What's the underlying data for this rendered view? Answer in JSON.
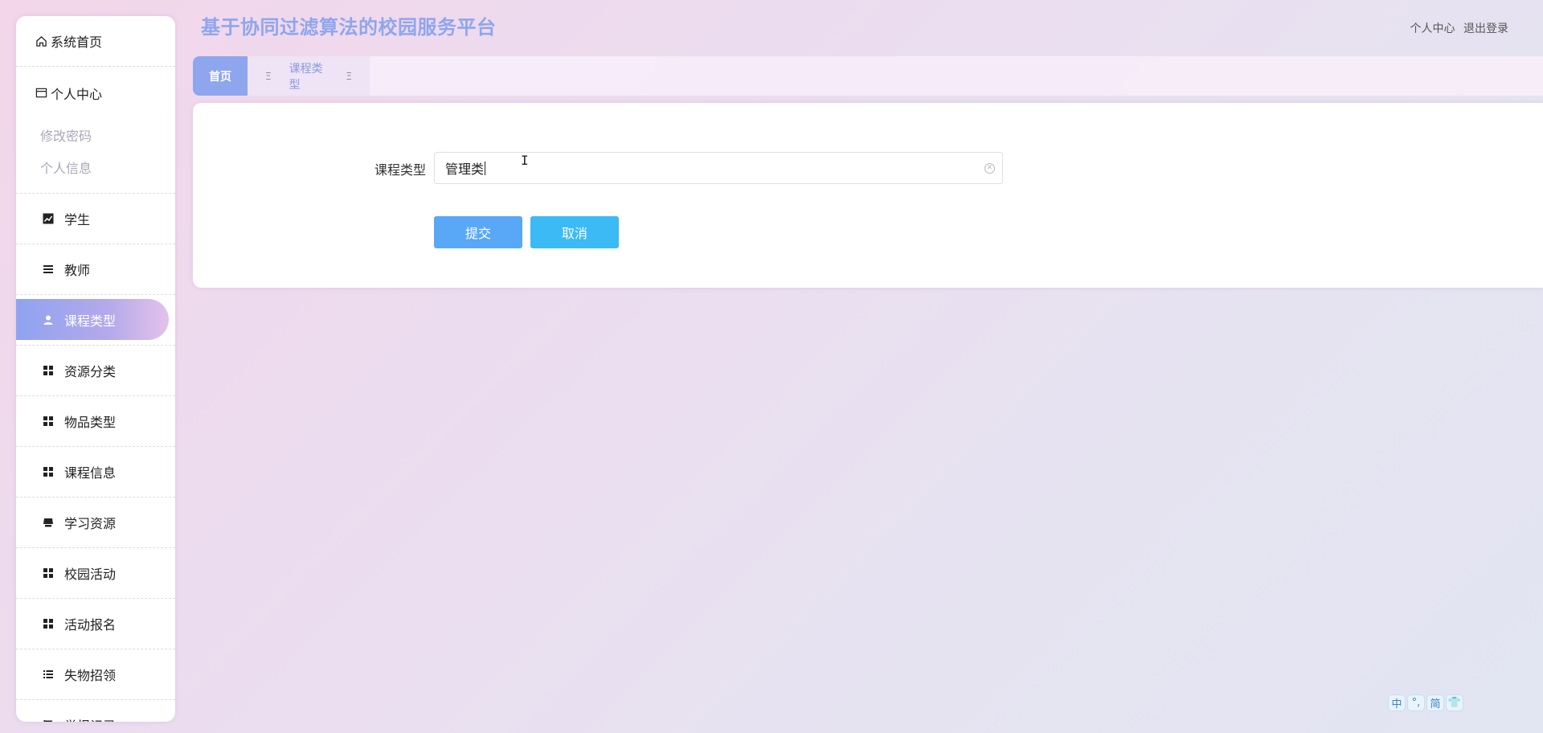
{
  "header": {
    "title": "基于协同过滤算法的校园服务平台",
    "profile_link": "个人中心",
    "logout_link": "退出登录"
  },
  "sidebar": {
    "home": {
      "label": "系统首页",
      "icon": "home-icon"
    },
    "personal": {
      "label": "个人中心",
      "icon": "card-icon",
      "children": [
        {
          "label": "修改密码"
        },
        {
          "label": "个人信息"
        }
      ]
    },
    "items": [
      {
        "label": "学生",
        "icon": "chart-icon"
      },
      {
        "label": "教师",
        "icon": "list-icon"
      },
      {
        "label": "课程类型",
        "icon": "user-icon",
        "active": true
      },
      {
        "label": "资源分类",
        "icon": "grid-icon"
      },
      {
        "label": "物品类型",
        "icon": "grid-icon"
      },
      {
        "label": "课程信息",
        "icon": "grid-icon"
      },
      {
        "label": "学习资源",
        "icon": "shop-icon"
      },
      {
        "label": "校园活动",
        "icon": "grid-icon"
      },
      {
        "label": "活动报名",
        "icon": "grid-icon"
      },
      {
        "label": "失物招领",
        "icon": "list-icon"
      },
      {
        "label": "举报记录",
        "icon": "flag-icon"
      }
    ]
  },
  "tabs": {
    "home": "首页",
    "current": "课程类型"
  },
  "form": {
    "label": "课程类型",
    "value": "管理类",
    "submit": "提交",
    "cancel": "取消"
  },
  "ime_toolbar": [
    "中",
    "°,",
    "简",
    "👕"
  ],
  "colors": {
    "title": "#8ea6ee",
    "submit_button": "#58a8f7",
    "cancel_button": "#3bbaf5",
    "active_menu_start": "#8fa3f0"
  }
}
